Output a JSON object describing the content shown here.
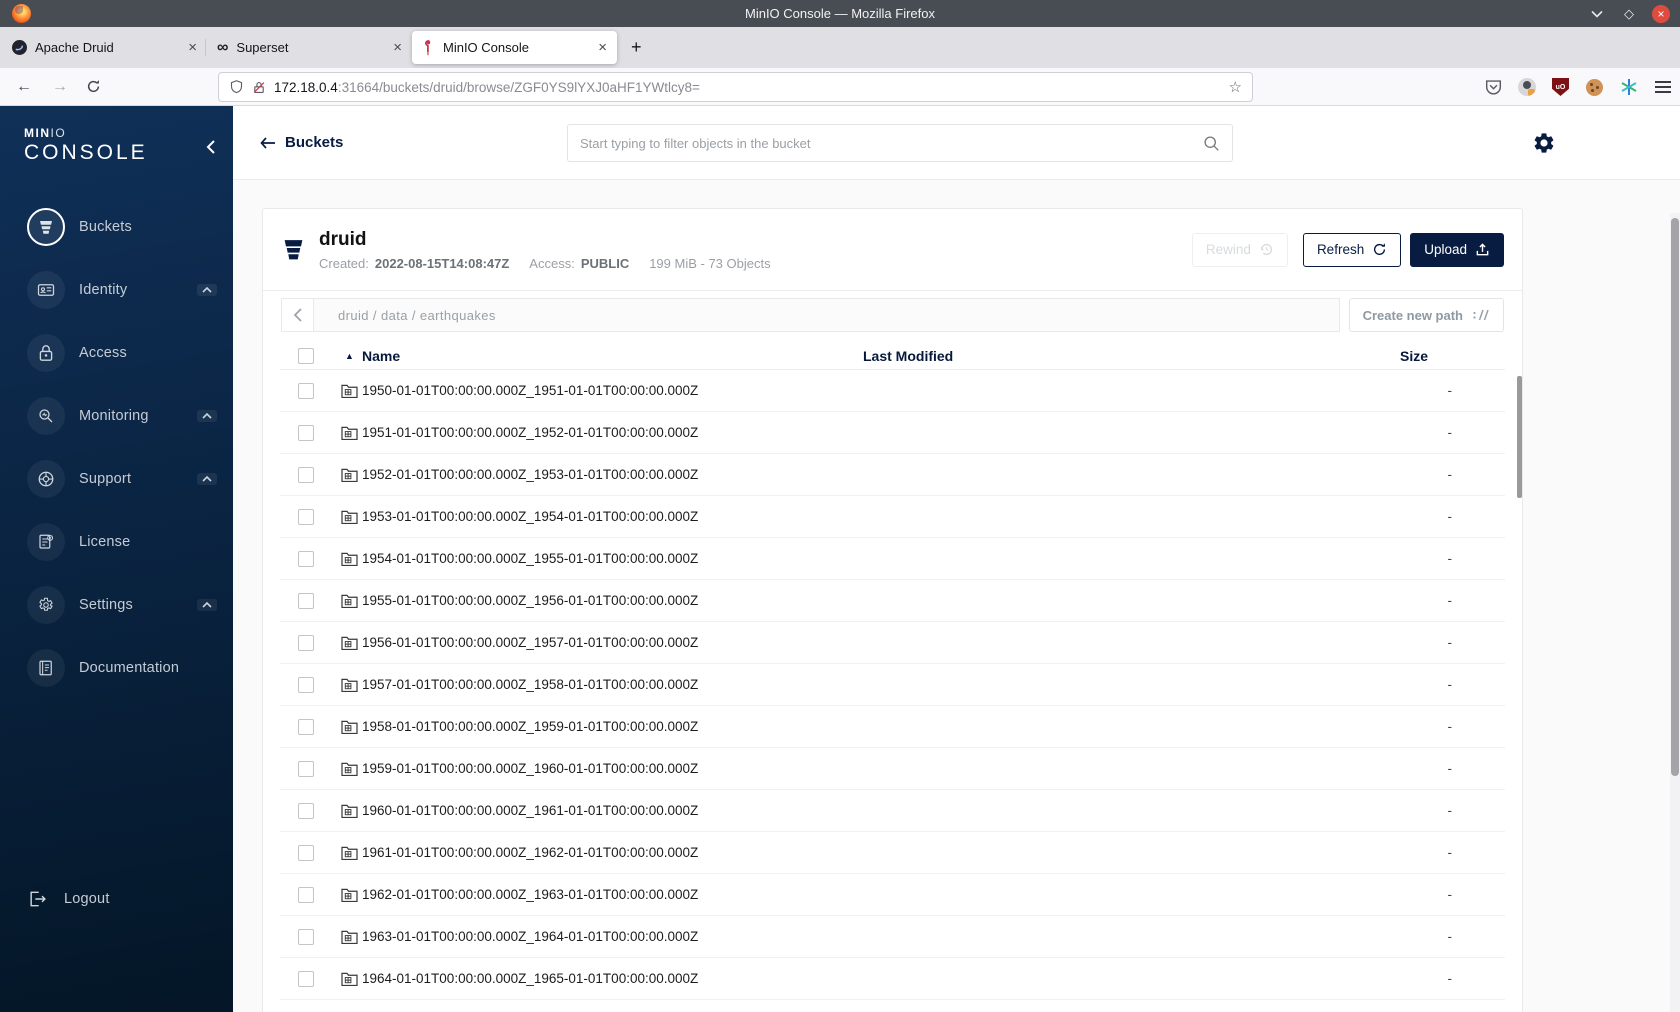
{
  "window": {
    "title": "MinIO Console — Mozilla Firefox"
  },
  "browser": {
    "tabs": [
      {
        "label": "Apache Druid"
      },
      {
        "label": "Superset"
      },
      {
        "label": "MinIO Console"
      }
    ],
    "url_host": "172.18.0.4",
    "url_rest": ":31664/buckets/druid/browse/ZGF0YS9lYXJ0aHF1YWtlcy8="
  },
  "sidebar": {
    "brand_bold": "MIN",
    "brand_light": "IO",
    "brand_name": "CONSOLE",
    "items": [
      {
        "label": "Buckets"
      },
      {
        "label": "Identity"
      },
      {
        "label": "Access"
      },
      {
        "label": "Monitoring"
      },
      {
        "label": "Support"
      },
      {
        "label": "License"
      },
      {
        "label": "Settings"
      },
      {
        "label": "Documentation"
      }
    ],
    "logout_label": "Logout"
  },
  "header": {
    "back_label": "Buckets",
    "search_placeholder": "Start typing to filter objects in the bucket"
  },
  "bucket": {
    "name": "druid",
    "created_label": "Created:",
    "created_value": "2022-08-15T14:08:47Z",
    "access_label": "Access:",
    "access_value": "PUBLIC",
    "usage": "199 MiB - 73 Objects",
    "rewind_label": "Rewind",
    "refresh_label": "Refresh",
    "upload_label": "Upload"
  },
  "path_bar": {
    "breadcrumb": "druid / data / earthquakes",
    "create_path_label": "Create new path"
  },
  "table": {
    "name_header": "Name",
    "last_modified_header": "Last Modified",
    "size_header": "Size",
    "rows": [
      {
        "name": "1950-01-01T00:00:00.000Z_1951-01-01T00:00:00.000Z",
        "size": "-"
      },
      {
        "name": "1951-01-01T00:00:00.000Z_1952-01-01T00:00:00.000Z",
        "size": "-"
      },
      {
        "name": "1952-01-01T00:00:00.000Z_1953-01-01T00:00:00.000Z",
        "size": "-"
      },
      {
        "name": "1953-01-01T00:00:00.000Z_1954-01-01T00:00:00.000Z",
        "size": "-"
      },
      {
        "name": "1954-01-01T00:00:00.000Z_1955-01-01T00:00:00.000Z",
        "size": "-"
      },
      {
        "name": "1955-01-01T00:00:00.000Z_1956-01-01T00:00:00.000Z",
        "size": "-"
      },
      {
        "name": "1956-01-01T00:00:00.000Z_1957-01-01T00:00:00.000Z",
        "size": "-"
      },
      {
        "name": "1957-01-01T00:00:00.000Z_1958-01-01T00:00:00.000Z",
        "size": "-"
      },
      {
        "name": "1958-01-01T00:00:00.000Z_1959-01-01T00:00:00.000Z",
        "size": "-"
      },
      {
        "name": "1959-01-01T00:00:00.000Z_1960-01-01T00:00:00.000Z",
        "size": "-"
      },
      {
        "name": "1960-01-01T00:00:00.000Z_1961-01-01T00:00:00.000Z",
        "size": "-"
      },
      {
        "name": "1961-01-01T00:00:00.000Z_1962-01-01T00:00:00.000Z",
        "size": "-"
      },
      {
        "name": "1962-01-01T00:00:00.000Z_1963-01-01T00:00:00.000Z",
        "size": "-"
      },
      {
        "name": "1963-01-01T00:00:00.000Z_1964-01-01T00:00:00.000Z",
        "size": "-"
      },
      {
        "name": "1964-01-01T00:00:00.000Z_1965-01-01T00:00:00.000Z",
        "size": "-"
      }
    ]
  }
}
